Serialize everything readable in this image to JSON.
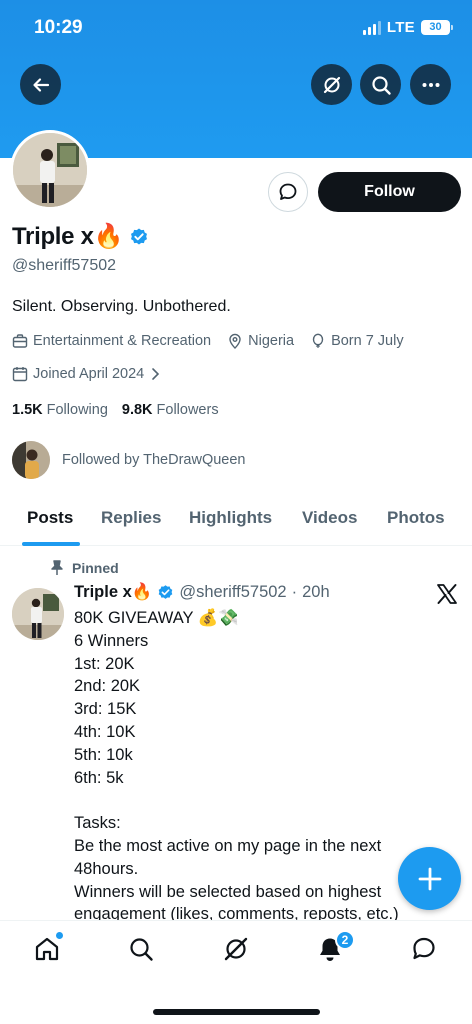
{
  "status_bar": {
    "time": "10:29",
    "network": "LTE",
    "battery": "30"
  },
  "colors": {
    "accent": "#1d9bf0",
    "banner": "#1f9bf0",
    "text_primary": "#0f1419",
    "text_secondary": "#536471"
  },
  "profile": {
    "name": "Triple x🔥",
    "handle": "@sheriff57502",
    "bio": "Silent. Observing. Unbothered.",
    "category": "Entertainment & Recreation",
    "location": "Nigeria",
    "born": "Born 7 July",
    "joined": "Joined April 2024",
    "following_count": "1.5K",
    "following_label": "Following",
    "followers_count": "9.8K",
    "followers_label": "Followers",
    "followed_by": "Followed by TheDrawQueen",
    "follow_button": "Follow"
  },
  "tabs": [
    {
      "label": "Posts",
      "active": true
    },
    {
      "label": "Replies"
    },
    {
      "label": "Highlights"
    },
    {
      "label": "Videos"
    },
    {
      "label": "Photos"
    }
  ],
  "pinned_post": {
    "pinned_label": "Pinned",
    "author": "Triple x🔥",
    "handle": "@sheriff57502",
    "separator": "·",
    "time": "20h",
    "lines": [
      "80K GIVEAWAY 💰💸",
      "6 Winners",
      "1st: 20K",
      "2nd: 20K",
      "3rd: 15K",
      "4th: 10K",
      "5th: 10k",
      "6th: 5k",
      "",
      "Tasks:",
      "Be the most active on my page in the next",
      "48hours.",
      "Winners will be selected based on highest",
      "engagement (likes, comments, reposts, etc.)"
    ]
  },
  "bottom_nav": {
    "notifications_badge": "2"
  },
  "icons": [
    "back-arrow-icon",
    "grok-icon",
    "search-icon",
    "more-icon",
    "message-icon",
    "briefcase-icon",
    "location-pin-icon",
    "balloon-icon",
    "calendar-icon",
    "chevron-right-icon",
    "verified-badge-icon",
    "pin-icon",
    "x-logo-icon",
    "plus-icon",
    "home-icon",
    "bell-icon"
  ]
}
